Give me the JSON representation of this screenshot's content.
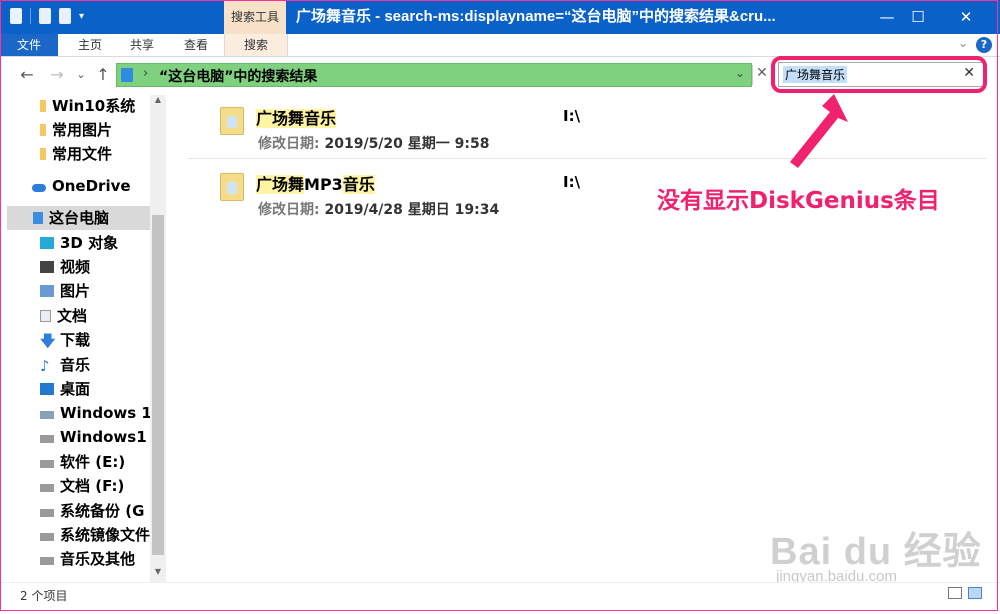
{
  "window": {
    "title": "广场舞音乐 - search-ms:displayname=“这台电脑”中的搜索结果&cru...",
    "context_tab": "搜索工具",
    "controls": {
      "minimize": "—",
      "maximize": "☐",
      "close": "✕"
    }
  },
  "ribbon": {
    "tabs": [
      "文件",
      "主页",
      "共享",
      "查看",
      "搜索"
    ],
    "help": "?"
  },
  "address": {
    "separator": "›",
    "path": "“这台电脑”中的搜索结果"
  },
  "search": {
    "query": "广场舞音乐"
  },
  "sidebar": {
    "items": [
      "Win10系统",
      "常用图片",
      "常用文件",
      "OneDrive",
      "这台电脑",
      "3D 对象",
      "视频",
      "图片",
      "文档",
      "下载",
      "音乐",
      "桌面",
      "Windows 1",
      "Windows1",
      "软件 (E:)",
      "文档 (F:)",
      "系统备份 (G",
      "系统镜像文件",
      "音乐及其他"
    ],
    "selected_index": 4
  },
  "results": [
    {
      "name_prefix": "",
      "name_highlight_1": "广场舞音乐",
      "name_middle": "",
      "name_highlight_2": "",
      "date_label": "修改日期:",
      "date_value": "2019/5/20 星期一 9:58",
      "location": "I:\\"
    },
    {
      "name_prefix": "",
      "name_highlight_1": "广场舞",
      "name_middle": "MP3",
      "name_highlight_2": "音乐",
      "date_label": "修改日期:",
      "date_value": "2019/4/28 星期日 19:34",
      "location": "I:\\"
    }
  ],
  "annotation": {
    "text": "没有显示DiskGenius条目",
    "color": "#f0226f"
  },
  "watermark": {
    "logo": "Bai du 经验",
    "url": "jingyan.baidu.com"
  },
  "status": {
    "count": "2 个项目"
  }
}
